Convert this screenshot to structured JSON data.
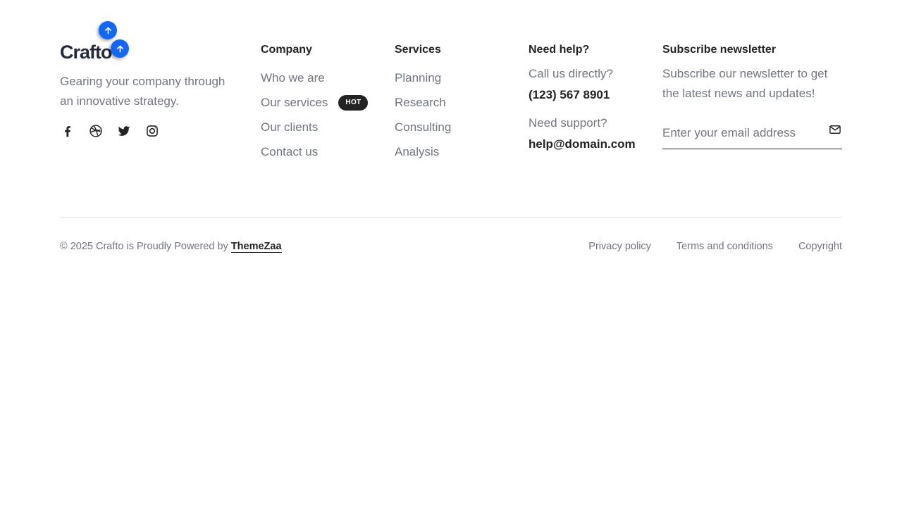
{
  "brand": {
    "logo_text": "Crafto",
    "tagline": "Gearing your company through an innovative strategy.",
    "scroll_icon": "arrow-up-icon",
    "socials": [
      {
        "name": "facebook-icon"
      },
      {
        "name": "dribbble-icon"
      },
      {
        "name": "twitter-icon"
      },
      {
        "name": "instagram-icon"
      }
    ]
  },
  "company": {
    "heading": "Company",
    "links": [
      "Who we are",
      "Our services",
      "Our clients",
      "Contact us"
    ],
    "badge": "HOT"
  },
  "services": {
    "heading": "Services",
    "links": [
      "Planning",
      "Research",
      "Consulting",
      "Analysis"
    ]
  },
  "help": {
    "heading": "Need help?",
    "call_label": "Call us directly?",
    "phone": "(123) 567 8901",
    "support_label": "Need support?",
    "email": "help@domain.com"
  },
  "newsletter": {
    "heading": "Subscribe newsletter",
    "text": "Subscribe our newsletter to get the latest news and updates!",
    "placeholder": "Enter your email address",
    "value": "",
    "send_icon": "envelope-icon"
  },
  "bottom": {
    "copyright_prefix": "© 2025 Crafto is Proudly Powered by",
    "copyright_link": "ThemeZaa",
    "legal_links": [
      "Privacy policy",
      "Terms and conditions",
      "Copyright"
    ]
  },
  "colors": {
    "accent": "#1467f5",
    "text_dark": "#232323",
    "text_muted": "#717580",
    "divider": "#e6e6e6"
  }
}
